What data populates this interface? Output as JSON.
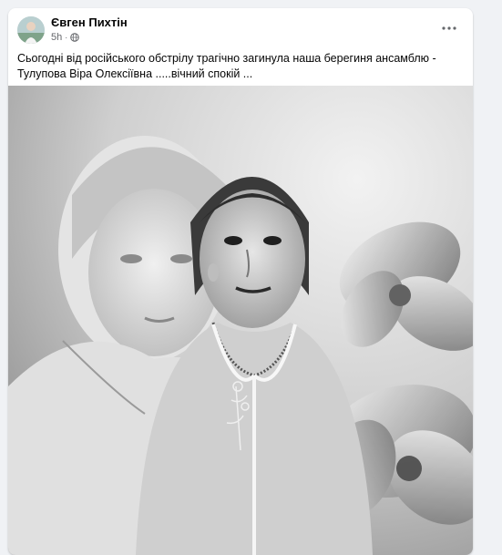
{
  "post": {
    "author_name": "Євген Пихтін",
    "timestamp": "5h",
    "separator": "·",
    "privacy_icon": "globe-icon",
    "more_icon": "more-horizontal-icon",
    "text": "Сьогодні від російського обстрілу трагічно загинула наша берегиня ансамблю - Тулупова Віра Олексіївна .....вічний спокій ..."
  },
  "colors": {
    "page_bg": "#f0f2f5",
    "card_bg": "#ffffff",
    "name_text": "#050505",
    "meta_text": "#65676b"
  }
}
